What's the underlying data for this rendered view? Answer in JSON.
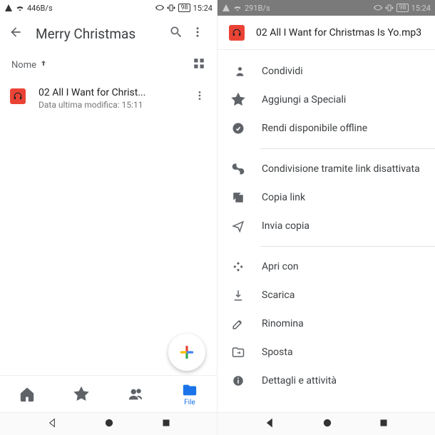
{
  "status_left": {
    "speed": "446B/s",
    "speed_right": "291B/s"
  },
  "status_right": {
    "battery": "98",
    "time": "15:24"
  },
  "toolbar": {
    "title": "Merry Christmas"
  },
  "sort": {
    "label": "Nome"
  },
  "file": {
    "name": "02 All I Want for Christ...",
    "sub": "Data ultima modifica: 15:11"
  },
  "bottom_nav": {
    "file_label": "File"
  },
  "sheet": {
    "title": "02 All I Want for Christmas Is Yo.mp3"
  },
  "menu": {
    "share": "Condividi",
    "star": "Aggiungi a Speciali",
    "offline": "Rendi disponibile offline",
    "link_off": "Condivisione tramite link disattivata",
    "copy_link": "Copia link",
    "send_copy": "Invia copia",
    "open_with": "Apri con",
    "download": "Scarica",
    "rename": "Rinomina",
    "move": "Sposta",
    "details": "Dettagli e attività"
  }
}
